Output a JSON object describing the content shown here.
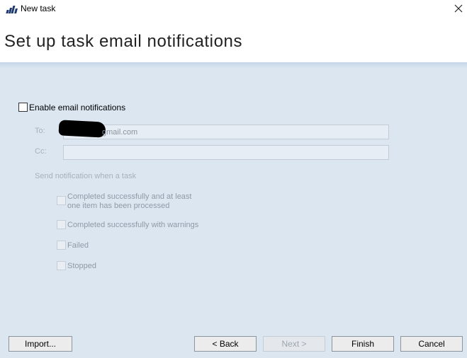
{
  "window": {
    "title": "New task"
  },
  "header": {
    "title": "Set up task email notifications"
  },
  "form": {
    "enable_label": "Enable email notifications",
    "enable_checked": false,
    "to_label": "To:",
    "to_value": "gmail.com",
    "cc_label": "Cc:",
    "cc_value": "",
    "section_label": "Send notification when a task",
    "options": [
      {
        "line1": "Completed successfully and at least",
        "line2": "one item has been processed",
        "checked": false
      },
      {
        "line1": "Completed successfully with warnings",
        "checked": false
      },
      {
        "line1": "Failed",
        "checked": false
      },
      {
        "line1": "Stopped",
        "checked": false
      }
    ]
  },
  "buttons": {
    "import": "Import...",
    "back": "< Back",
    "next": "Next >",
    "finish": "Finish",
    "cancel": "Cancel"
  },
  "colors": {
    "content_bg": "#dbe6f1",
    "brand_icon": "#1f3a6e"
  },
  "icons": {
    "app": "veeam-logo-icon",
    "close": "close-icon"
  }
}
